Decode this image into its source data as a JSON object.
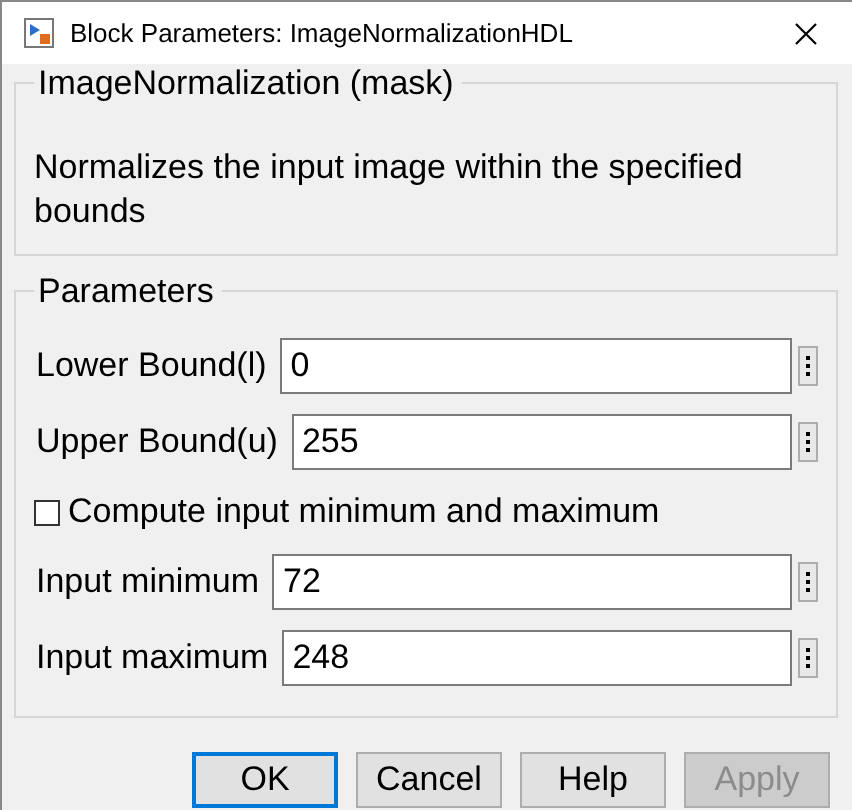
{
  "window": {
    "title": "Block Parameters: ImageNormalizationHDL"
  },
  "mask": {
    "title": "ImageNormalization (mask)",
    "description": "Normalizes the input image within the specified bounds"
  },
  "parameters": {
    "title": "Parameters",
    "items": [
      {
        "kind": "field",
        "label": "Lower Bound(l)",
        "value": "0"
      },
      {
        "kind": "field",
        "label": "Upper Bound(u)",
        "value": "255"
      },
      {
        "kind": "checkbox",
        "label": "Compute input minimum and maximum",
        "checked": false
      },
      {
        "kind": "field",
        "label": "Input minimum",
        "value": "72"
      },
      {
        "kind": "field",
        "label": "Input maximum",
        "value": "248"
      }
    ]
  },
  "buttons": [
    {
      "label": "OK",
      "default": true,
      "disabled": false
    },
    {
      "label": "Cancel",
      "default": false,
      "disabled": false
    },
    {
      "label": "Help",
      "default": false,
      "disabled": false
    },
    {
      "label": "Apply",
      "default": false,
      "disabled": true
    }
  ]
}
